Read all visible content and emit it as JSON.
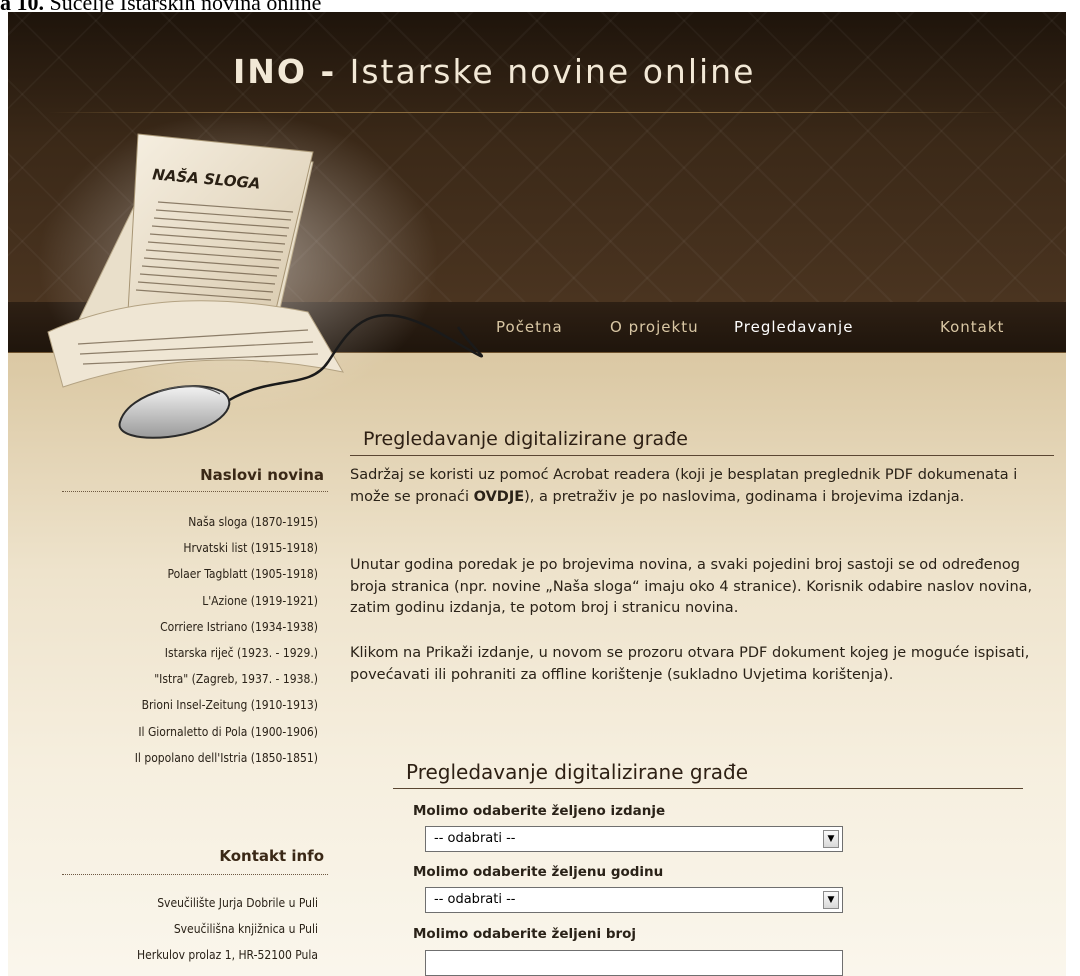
{
  "caption": {
    "prefix": "a 10.",
    "text": " Sučelje Istarskih novina online"
  },
  "header": {
    "title_bold": "INO - ",
    "title_rest": "Istarske novine online",
    "newspaper_name": "NAŠA SLOGA"
  },
  "nav": {
    "items": [
      {
        "label": "Početna",
        "active": false
      },
      {
        "label": "O projektu",
        "active": false
      },
      {
        "label": "Pregledavanje",
        "active": true
      },
      {
        "label": "Kontakt",
        "active": false
      }
    ]
  },
  "sidebar": {
    "titles_heading": "Naslovi novina",
    "titles": [
      "Naša sloga (1870-1915)",
      "Hrvatski list (1915-1918)",
      "Polaer Tagblatt (1905-1918)",
      "L'Azione (1919-1921)",
      "Corriere Istriano (1934-1938)",
      "Istarska riječ (1923. - 1929.)",
      "\"Istra\" (Zagreb, 1937. - 1938.)",
      "Brioni Insel-Zeitung (1910-1913)",
      "Il Giornaletto di Pola (1900-1906)",
      "Il popolano dell'Istria (1850-1851)"
    ],
    "contact_heading": "Kontakt info",
    "contact": [
      "Sveučilište Jurja Dobrile u Puli",
      "Sveučilišna knjižnica u Puli",
      "Herkulov prolaz 1, HR-52100 Pula"
    ]
  },
  "main": {
    "heading": "Pregledavanje digitalizirane građe",
    "p1_before": "Sadržaj se koristi uz pomoć Acrobat readera (koji je besplatan preglednik PDF dokumenata i može se pronaći ",
    "p1_link": "OVDJE",
    "p1_after": "), a pretraživ je po naslovima, godinama i brojevima izdanja.",
    "p2": "Unutar godina poredak je po brojevima novina, a svaki pojedini broj sastoji se od određenog broja stranica (npr. novine „Naša sloga“ imaju oko 4 stranice). Korisnik odabire naslov novina, zatim godinu izdanja, te potom broj i stranicu novina.",
    "p3": "Klikom na Prikaži izdanje, u novom se prozoru otvara PDF dokument kojeg je moguće ispisati, povećavati ili pohraniti za offline korištenje (sukladno Uvjetima korištenja)."
  },
  "form": {
    "heading": "Pregledavanje digitalizirane građe",
    "edition_label": "Molimo odaberite željeno izdanje",
    "edition_value": "-- odabrati --",
    "year_label": "Molimo odaberite željenu godinu",
    "year_value": "-- odabrati --",
    "number_label": "Molimo odaberite željeni broj"
  }
}
